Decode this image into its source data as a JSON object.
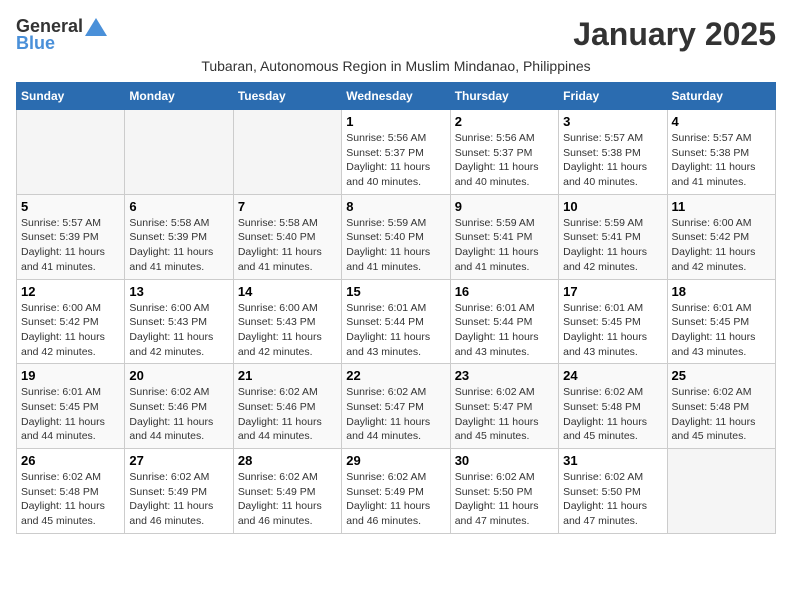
{
  "header": {
    "logo_general": "General",
    "logo_blue": "Blue",
    "month_title": "January 2025",
    "subtitle": "Tubaran, Autonomous Region in Muslim Mindanao, Philippines"
  },
  "weekdays": [
    "Sunday",
    "Monday",
    "Tuesday",
    "Wednesday",
    "Thursday",
    "Friday",
    "Saturday"
  ],
  "weeks": [
    [
      {
        "day": "",
        "empty": true
      },
      {
        "day": "",
        "empty": true
      },
      {
        "day": "",
        "empty": true
      },
      {
        "day": "1",
        "sunrise": "Sunrise: 5:56 AM",
        "sunset": "Sunset: 5:37 PM",
        "daylight": "Daylight: 11 hours and 40 minutes."
      },
      {
        "day": "2",
        "sunrise": "Sunrise: 5:56 AM",
        "sunset": "Sunset: 5:37 PM",
        "daylight": "Daylight: 11 hours and 40 minutes."
      },
      {
        "day": "3",
        "sunrise": "Sunrise: 5:57 AM",
        "sunset": "Sunset: 5:38 PM",
        "daylight": "Daylight: 11 hours and 40 minutes."
      },
      {
        "day": "4",
        "sunrise": "Sunrise: 5:57 AM",
        "sunset": "Sunset: 5:38 PM",
        "daylight": "Daylight: 11 hours and 41 minutes."
      }
    ],
    [
      {
        "day": "5",
        "sunrise": "Sunrise: 5:57 AM",
        "sunset": "Sunset: 5:39 PM",
        "daylight": "Daylight: 11 hours and 41 minutes."
      },
      {
        "day": "6",
        "sunrise": "Sunrise: 5:58 AM",
        "sunset": "Sunset: 5:39 PM",
        "daylight": "Daylight: 11 hours and 41 minutes."
      },
      {
        "day": "7",
        "sunrise": "Sunrise: 5:58 AM",
        "sunset": "Sunset: 5:40 PM",
        "daylight": "Daylight: 11 hours and 41 minutes."
      },
      {
        "day": "8",
        "sunrise": "Sunrise: 5:59 AM",
        "sunset": "Sunset: 5:40 PM",
        "daylight": "Daylight: 11 hours and 41 minutes."
      },
      {
        "day": "9",
        "sunrise": "Sunrise: 5:59 AM",
        "sunset": "Sunset: 5:41 PM",
        "daylight": "Daylight: 11 hours and 41 minutes."
      },
      {
        "day": "10",
        "sunrise": "Sunrise: 5:59 AM",
        "sunset": "Sunset: 5:41 PM",
        "daylight": "Daylight: 11 hours and 42 minutes."
      },
      {
        "day": "11",
        "sunrise": "Sunrise: 6:00 AM",
        "sunset": "Sunset: 5:42 PM",
        "daylight": "Daylight: 11 hours and 42 minutes."
      }
    ],
    [
      {
        "day": "12",
        "sunrise": "Sunrise: 6:00 AM",
        "sunset": "Sunset: 5:42 PM",
        "daylight": "Daylight: 11 hours and 42 minutes."
      },
      {
        "day": "13",
        "sunrise": "Sunrise: 6:00 AM",
        "sunset": "Sunset: 5:43 PM",
        "daylight": "Daylight: 11 hours and 42 minutes."
      },
      {
        "day": "14",
        "sunrise": "Sunrise: 6:00 AM",
        "sunset": "Sunset: 5:43 PM",
        "daylight": "Daylight: 11 hours and 42 minutes."
      },
      {
        "day": "15",
        "sunrise": "Sunrise: 6:01 AM",
        "sunset": "Sunset: 5:44 PM",
        "daylight": "Daylight: 11 hours and 43 minutes."
      },
      {
        "day": "16",
        "sunrise": "Sunrise: 6:01 AM",
        "sunset": "Sunset: 5:44 PM",
        "daylight": "Daylight: 11 hours and 43 minutes."
      },
      {
        "day": "17",
        "sunrise": "Sunrise: 6:01 AM",
        "sunset": "Sunset: 5:45 PM",
        "daylight": "Daylight: 11 hours and 43 minutes."
      },
      {
        "day": "18",
        "sunrise": "Sunrise: 6:01 AM",
        "sunset": "Sunset: 5:45 PM",
        "daylight": "Daylight: 11 hours and 43 minutes."
      }
    ],
    [
      {
        "day": "19",
        "sunrise": "Sunrise: 6:01 AM",
        "sunset": "Sunset: 5:45 PM",
        "daylight": "Daylight: 11 hours and 44 minutes."
      },
      {
        "day": "20",
        "sunrise": "Sunrise: 6:02 AM",
        "sunset": "Sunset: 5:46 PM",
        "daylight": "Daylight: 11 hours and 44 minutes."
      },
      {
        "day": "21",
        "sunrise": "Sunrise: 6:02 AM",
        "sunset": "Sunset: 5:46 PM",
        "daylight": "Daylight: 11 hours and 44 minutes."
      },
      {
        "day": "22",
        "sunrise": "Sunrise: 6:02 AM",
        "sunset": "Sunset: 5:47 PM",
        "daylight": "Daylight: 11 hours and 44 minutes."
      },
      {
        "day": "23",
        "sunrise": "Sunrise: 6:02 AM",
        "sunset": "Sunset: 5:47 PM",
        "daylight": "Daylight: 11 hours and 45 minutes."
      },
      {
        "day": "24",
        "sunrise": "Sunrise: 6:02 AM",
        "sunset": "Sunset: 5:48 PM",
        "daylight": "Daylight: 11 hours and 45 minutes."
      },
      {
        "day": "25",
        "sunrise": "Sunrise: 6:02 AM",
        "sunset": "Sunset: 5:48 PM",
        "daylight": "Daylight: 11 hours and 45 minutes."
      }
    ],
    [
      {
        "day": "26",
        "sunrise": "Sunrise: 6:02 AM",
        "sunset": "Sunset: 5:48 PM",
        "daylight": "Daylight: 11 hours and 45 minutes."
      },
      {
        "day": "27",
        "sunrise": "Sunrise: 6:02 AM",
        "sunset": "Sunset: 5:49 PM",
        "daylight": "Daylight: 11 hours and 46 minutes."
      },
      {
        "day": "28",
        "sunrise": "Sunrise: 6:02 AM",
        "sunset": "Sunset: 5:49 PM",
        "daylight": "Daylight: 11 hours and 46 minutes."
      },
      {
        "day": "29",
        "sunrise": "Sunrise: 6:02 AM",
        "sunset": "Sunset: 5:49 PM",
        "daylight": "Daylight: 11 hours and 46 minutes."
      },
      {
        "day": "30",
        "sunrise": "Sunrise: 6:02 AM",
        "sunset": "Sunset: 5:50 PM",
        "daylight": "Daylight: 11 hours and 47 minutes."
      },
      {
        "day": "31",
        "sunrise": "Sunrise: 6:02 AM",
        "sunset": "Sunset: 5:50 PM",
        "daylight": "Daylight: 11 hours and 47 minutes."
      },
      {
        "day": "",
        "empty": true
      }
    ]
  ]
}
